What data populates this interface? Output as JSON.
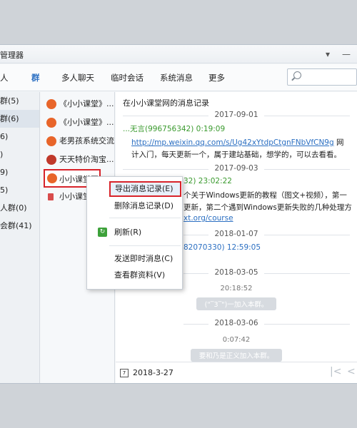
{
  "window": {
    "title": "管理器"
  },
  "tabs": [
    "人",
    "群",
    "多人聊天",
    "临时会话",
    "系统消息",
    "更多"
  ],
  "left_list": [
    "群(5)",
    "群(6)",
    "6)",
    ")",
    "9)",
    "5)",
    "人群(0)",
    "会群(41)"
  ],
  "groups": [
    {
      "label": "《小小课堂》...",
      "icon_color": "#e8652a"
    },
    {
      "label": "《小小课堂》...",
      "icon_color": "#e8652a"
    },
    {
      "label": "老男孩系统交流",
      "icon_color": "#e8652a"
    },
    {
      "label": "天天特价淘宝...",
      "icon_color": "#c0392b"
    },
    {
      "label": "小小课堂网",
      "icon_color": "#e8652a"
    },
    {
      "label": "小小课堂",
      "icon_color": "#d84c4c"
    }
  ],
  "content": {
    "header": "在小小课堂网的消息记录",
    "dates": [
      "2017-09-01",
      "2017-09-03",
      "2018-01-07",
      "2018-03-05",
      "2018-03-06"
    ],
    "msg1_sender": "...无言(996756342) 0:19:09",
    "msg1_link": "http://mp.weixin.qq.com/s/Ug42xYtdpCtgnFNbVfCN9g",
    "msg1_link_tail": "网",
    "msg1_text": "计入门，每天更新一个，属于建站基础，想学的，可以去看看。",
    "msg2_sender": "32) 23:02:22",
    "msg2_text1": "个关于Windows更新的教程（图文+视频），第一",
    "msg2_text2": "更新，第二个遇到Windows更新失败的几种处理方",
    "msg2_link": "xt.org/course",
    "msg3_sender": "82070330) 12:59:05",
    "time1": "20:18:52",
    "sys1": "(\"‾3‾\")一加入本群。",
    "time2": "0:07:42",
    "sys2": "要和乃是正义加入本群。",
    "bottom_date": "2018-3-27"
  },
  "context_menu": {
    "export": "导出消息记录(E)",
    "delete": "删除消息记录(D)",
    "refresh": "刷新(R)",
    "send": "发送即时消息(C)",
    "view": "查看群资料(V)"
  },
  "icons": {
    "search": "search-icon",
    "calendar": "calendar-icon",
    "refresh": "refresh-icon"
  }
}
